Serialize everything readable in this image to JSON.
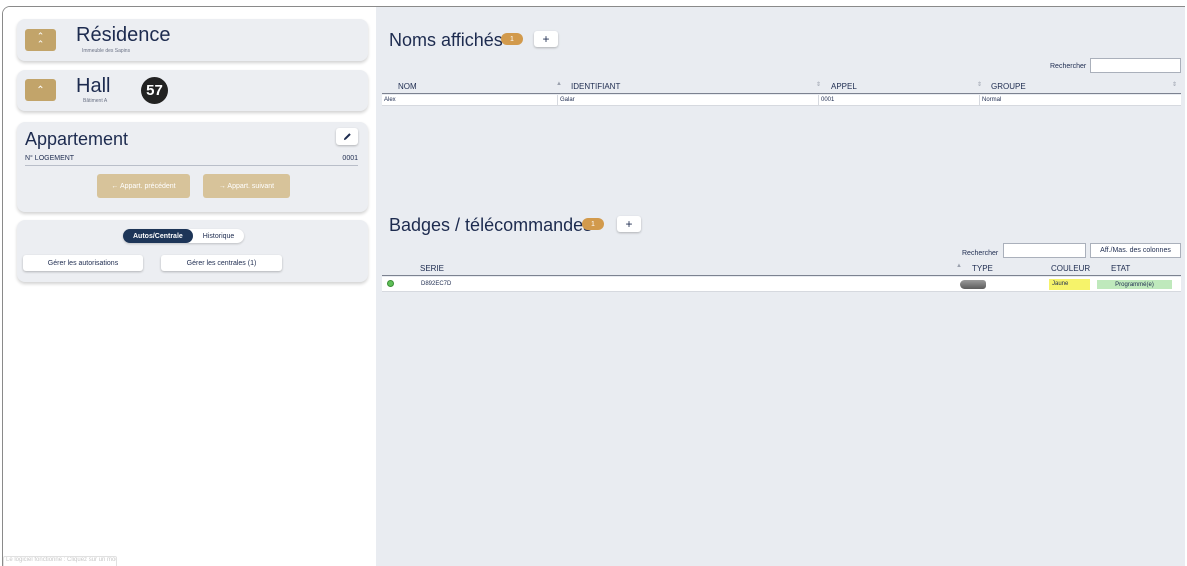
{
  "residence": {
    "title": "Résidence",
    "subtitle": "Immeuble des Sapins",
    "toggle_icon": "double-chevron-up-icon"
  },
  "hall": {
    "title": "Hall",
    "subtitle": "Bâtiment A",
    "toggle_icon": "chevron-up-icon",
    "badge": "57"
  },
  "appartement": {
    "title": "Appartement",
    "edit_icon": "pencil-icon",
    "logement_label": "N° LOGEMENT",
    "logement_value": "0001",
    "prev_label": "← Appart. précédent",
    "next_label": "→ Appart. suivant"
  },
  "tabs": {
    "active": "Autos/Centrale",
    "inactive": "Historique"
  },
  "actions": {
    "autorisations": "Gérer les autorisations",
    "centrales": "Gérer les centrales (1)"
  },
  "noms": {
    "title": "Noms affichés",
    "count": "1",
    "add": "+",
    "search_label": "Rechercher",
    "search_value": "",
    "columns": [
      "NOM",
      "IDENTIFIANT",
      "APPEL",
      "GROUPE"
    ],
    "rows": [
      {
        "nom": "Alex",
        "identifiant": "Galar",
        "appel": "0001",
        "groupe": "Normal"
      }
    ]
  },
  "badges": {
    "title": "Badges / télécommandes",
    "count": "1",
    "add": "+",
    "search_label": "Rechercher",
    "search_value": "",
    "cols_button": "Aff./Mas. des colonnes",
    "columns": [
      "SERIE",
      "TYPE",
      "COULEUR",
      "ETAT"
    ],
    "rows": [
      {
        "serie": "D892EC7D",
        "type_icon": "key-fob-icon",
        "couleur": "Jaune",
        "etat": "Programmé(e)"
      }
    ],
    "colors": {
      "jaune": "#f6f36a",
      "programme": "#bfe9bc"
    }
  },
  "footer": {
    "text": "Le logiciel fonctionne : Cliquez sur un module"
  },
  "theme": {
    "gold": "#c2a46a",
    "navy": "#1d3558",
    "pill": "#d29a4c"
  }
}
